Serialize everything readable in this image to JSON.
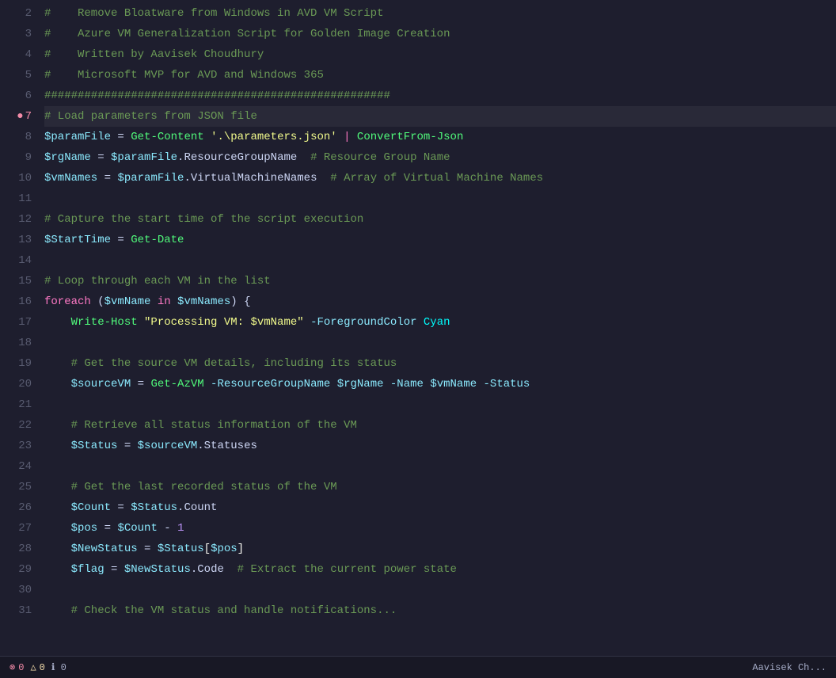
{
  "editor": {
    "lines": [
      {
        "num": 2,
        "active": false,
        "breakpoint": false,
        "tokens": [
          {
            "text": "#    Remove Bloatware from Windows in AVD VM Script",
            "class": "comment"
          }
        ]
      },
      {
        "num": 3,
        "active": false,
        "breakpoint": false,
        "tokens": [
          {
            "text": "#    Azure VM Generalization Script for Golden Image Creation",
            "class": "comment"
          }
        ]
      },
      {
        "num": 4,
        "active": false,
        "breakpoint": false,
        "tokens": [
          {
            "text": "#    Written by Aavisek Choudhury",
            "class": "comment"
          }
        ]
      },
      {
        "num": 5,
        "active": false,
        "breakpoint": false,
        "tokens": [
          {
            "text": "#    Microsoft MVP for AVD ",
            "class": "comment"
          },
          {
            "text": "and",
            "class": "comment"
          },
          {
            "text": " Windows 365",
            "class": "comment"
          }
        ]
      },
      {
        "num": 6,
        "active": false,
        "breakpoint": false,
        "tokens": [
          {
            "text": "####################################################",
            "class": "comment"
          }
        ]
      },
      {
        "num": 7,
        "active": true,
        "breakpoint": true,
        "tokens": [
          {
            "text": "# Load parameters from JSON file",
            "class": "comment"
          }
        ]
      },
      {
        "num": 8,
        "active": false,
        "breakpoint": false,
        "tokens": [
          {
            "text": "$paramFile",
            "class": "variable"
          },
          {
            "text": " = ",
            "class": "operator"
          },
          {
            "text": "Get-Content",
            "class": "cmdlet"
          },
          {
            "text": " ",
            "class": "operator"
          },
          {
            "text": "'.\\parameters.json'",
            "class": "string"
          },
          {
            "text": " ",
            "class": "operator"
          },
          {
            "text": "|",
            "class": "pipe"
          },
          {
            "text": " ",
            "class": "operator"
          },
          {
            "text": "ConvertFrom-Json",
            "class": "cmdlet"
          }
        ]
      },
      {
        "num": 9,
        "active": false,
        "breakpoint": false,
        "tokens": [
          {
            "text": "$rgName",
            "class": "variable"
          },
          {
            "text": " = ",
            "class": "operator"
          },
          {
            "text": "$paramFile",
            "class": "variable"
          },
          {
            "text": ".ResourceGroupName  ",
            "class": "property"
          },
          {
            "text": "# Resource Group Name",
            "class": "comment"
          }
        ]
      },
      {
        "num": 10,
        "active": false,
        "breakpoint": false,
        "tokens": [
          {
            "text": "$vmNames",
            "class": "variable"
          },
          {
            "text": " = ",
            "class": "operator"
          },
          {
            "text": "$paramFile",
            "class": "variable"
          },
          {
            "text": ".VirtualMachineNames  ",
            "class": "property"
          },
          {
            "text": "# Array of Virtual Machine Names",
            "class": "comment"
          }
        ]
      },
      {
        "num": 11,
        "active": false,
        "breakpoint": false,
        "tokens": [
          {
            "text": "",
            "class": ""
          }
        ]
      },
      {
        "num": 12,
        "active": false,
        "breakpoint": false,
        "tokens": [
          {
            "text": "# Capture the start time of the script execution",
            "class": "comment"
          }
        ]
      },
      {
        "num": 13,
        "active": false,
        "breakpoint": false,
        "tokens": [
          {
            "text": "$StartTime",
            "class": "variable"
          },
          {
            "text": " = ",
            "class": "operator"
          },
          {
            "text": "Get-Date",
            "class": "cmdlet"
          }
        ]
      },
      {
        "num": 14,
        "active": false,
        "breakpoint": false,
        "tokens": [
          {
            "text": "",
            "class": ""
          }
        ]
      },
      {
        "num": 15,
        "active": false,
        "breakpoint": false,
        "tokens": [
          {
            "text": "# Loop through each VM in the list",
            "class": "comment"
          }
        ]
      },
      {
        "num": 16,
        "active": false,
        "breakpoint": false,
        "tokens": [
          {
            "text": "foreach",
            "class": "keyword"
          },
          {
            "text": " (",
            "class": "operator"
          },
          {
            "text": "$vmName",
            "class": "variable"
          },
          {
            "text": " in ",
            "class": "keyword"
          },
          {
            "text": "$vmNames",
            "class": "variable"
          },
          {
            "text": ") {",
            "class": "operator"
          }
        ]
      },
      {
        "num": 17,
        "active": false,
        "breakpoint": false,
        "tokens": [
          {
            "text": "    Write-Host ",
            "class": "cmdlet"
          },
          {
            "text": "\"Processing VM: $vmName\"",
            "class": "string"
          },
          {
            "text": " -ForegroundColor ",
            "class": "param-name"
          },
          {
            "text": "Cyan",
            "class": "cyan-text"
          }
        ]
      },
      {
        "num": 18,
        "active": false,
        "breakpoint": false,
        "tokens": [
          {
            "text": "",
            "class": ""
          }
        ]
      },
      {
        "num": 19,
        "active": false,
        "breakpoint": false,
        "tokens": [
          {
            "text": "    # Get the source VM details, including its status",
            "class": "comment"
          }
        ]
      },
      {
        "num": 20,
        "active": false,
        "breakpoint": false,
        "tokens": [
          {
            "text": "    $sourceVM",
            "class": "variable"
          },
          {
            "text": " = ",
            "class": "operator"
          },
          {
            "text": "Get-AzVM",
            "class": "cmdlet"
          },
          {
            "text": " -ResourceGroupName ",
            "class": "param-name"
          },
          {
            "text": "$rgName",
            "class": "variable"
          },
          {
            "text": " -Name ",
            "class": "param-name"
          },
          {
            "text": "$vmName",
            "class": "variable"
          },
          {
            "text": " -Status",
            "class": "param-name"
          }
        ]
      },
      {
        "num": 21,
        "active": false,
        "breakpoint": false,
        "tokens": [
          {
            "text": "",
            "class": ""
          }
        ]
      },
      {
        "num": 22,
        "active": false,
        "breakpoint": false,
        "tokens": [
          {
            "text": "    # Retrieve all status information of the VM",
            "class": "comment"
          }
        ]
      },
      {
        "num": 23,
        "active": false,
        "breakpoint": false,
        "tokens": [
          {
            "text": "    $Status",
            "class": "variable"
          },
          {
            "text": " = ",
            "class": "operator"
          },
          {
            "text": "$sourceVM",
            "class": "variable"
          },
          {
            "text": ".Statuses",
            "class": "property"
          }
        ]
      },
      {
        "num": 24,
        "active": false,
        "breakpoint": false,
        "tokens": [
          {
            "text": "",
            "class": ""
          }
        ]
      },
      {
        "num": 25,
        "active": false,
        "breakpoint": false,
        "tokens": [
          {
            "text": "    # Get the last recorded status of the VM",
            "class": "comment"
          }
        ]
      },
      {
        "num": 26,
        "active": false,
        "breakpoint": false,
        "tokens": [
          {
            "text": "    $Count",
            "class": "variable"
          },
          {
            "text": " = ",
            "class": "operator"
          },
          {
            "text": "$Status",
            "class": "variable"
          },
          {
            "text": ".Count",
            "class": "property"
          }
        ]
      },
      {
        "num": 27,
        "active": false,
        "breakpoint": false,
        "tokens": [
          {
            "text": "    $pos",
            "class": "variable"
          },
          {
            "text": " = ",
            "class": "operator"
          },
          {
            "text": "$Count",
            "class": "variable"
          },
          {
            "text": " - ",
            "class": "operator"
          },
          {
            "text": "1",
            "class": "number"
          }
        ]
      },
      {
        "num": 28,
        "active": false,
        "breakpoint": false,
        "tokens": [
          {
            "text": "    $NewStatus",
            "class": "variable"
          },
          {
            "text": " = ",
            "class": "operator"
          },
          {
            "text": "$Status",
            "class": "variable"
          },
          {
            "text": "[",
            "class": "bracket"
          },
          {
            "text": "$pos",
            "class": "variable"
          },
          {
            "text": "]",
            "class": "bracket"
          }
        ]
      },
      {
        "num": 29,
        "active": false,
        "breakpoint": false,
        "tokens": [
          {
            "text": "    $flag",
            "class": "variable"
          },
          {
            "text": " = ",
            "class": "operator"
          },
          {
            "text": "$NewStatus",
            "class": "variable"
          },
          {
            "text": ".Code  ",
            "class": "property"
          },
          {
            "text": "# Extract the current power state",
            "class": "comment"
          }
        ]
      },
      {
        "num": 30,
        "active": false,
        "breakpoint": false,
        "tokens": [
          {
            "text": "",
            "class": ""
          }
        ]
      },
      {
        "num": 31,
        "active": false,
        "breakpoint": false,
        "tokens": [
          {
            "text": "    # Check the VM status and handle notifications...",
            "class": "comment"
          }
        ]
      }
    ]
  },
  "status_bar": {
    "left_icon": "⊗",
    "errors": "0",
    "warnings": "△",
    "warning_count": "0",
    "info_icon": "ℹ",
    "info_count": "0",
    "right_text": "Aavisek Ch..."
  }
}
